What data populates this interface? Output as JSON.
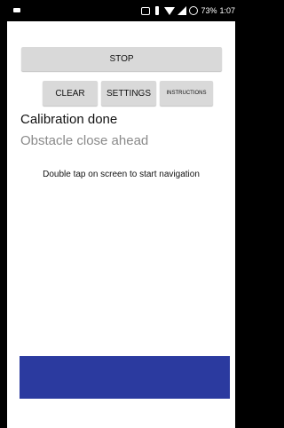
{
  "status_bar": {
    "battery_percent": "73%",
    "time": "1:07",
    "icons": [
      "nfc-icon",
      "vibrate-icon",
      "wifi-icon",
      "signal-icon",
      "battery-icon"
    ]
  },
  "buttons": {
    "stop": "STOP",
    "clear": "CLEAR",
    "settings": "SETTINGS",
    "instructions": "INSTRUCTIONS"
  },
  "status": {
    "calibration": "Calibration done",
    "obstacle": "Obstacle close ahead"
  },
  "hint": "Double tap on screen to start navigation",
  "colors": {
    "button_bg": "#d9d9d9",
    "nav_panel": "#2b3a9f",
    "secondary_text": "#8a8a8a"
  }
}
